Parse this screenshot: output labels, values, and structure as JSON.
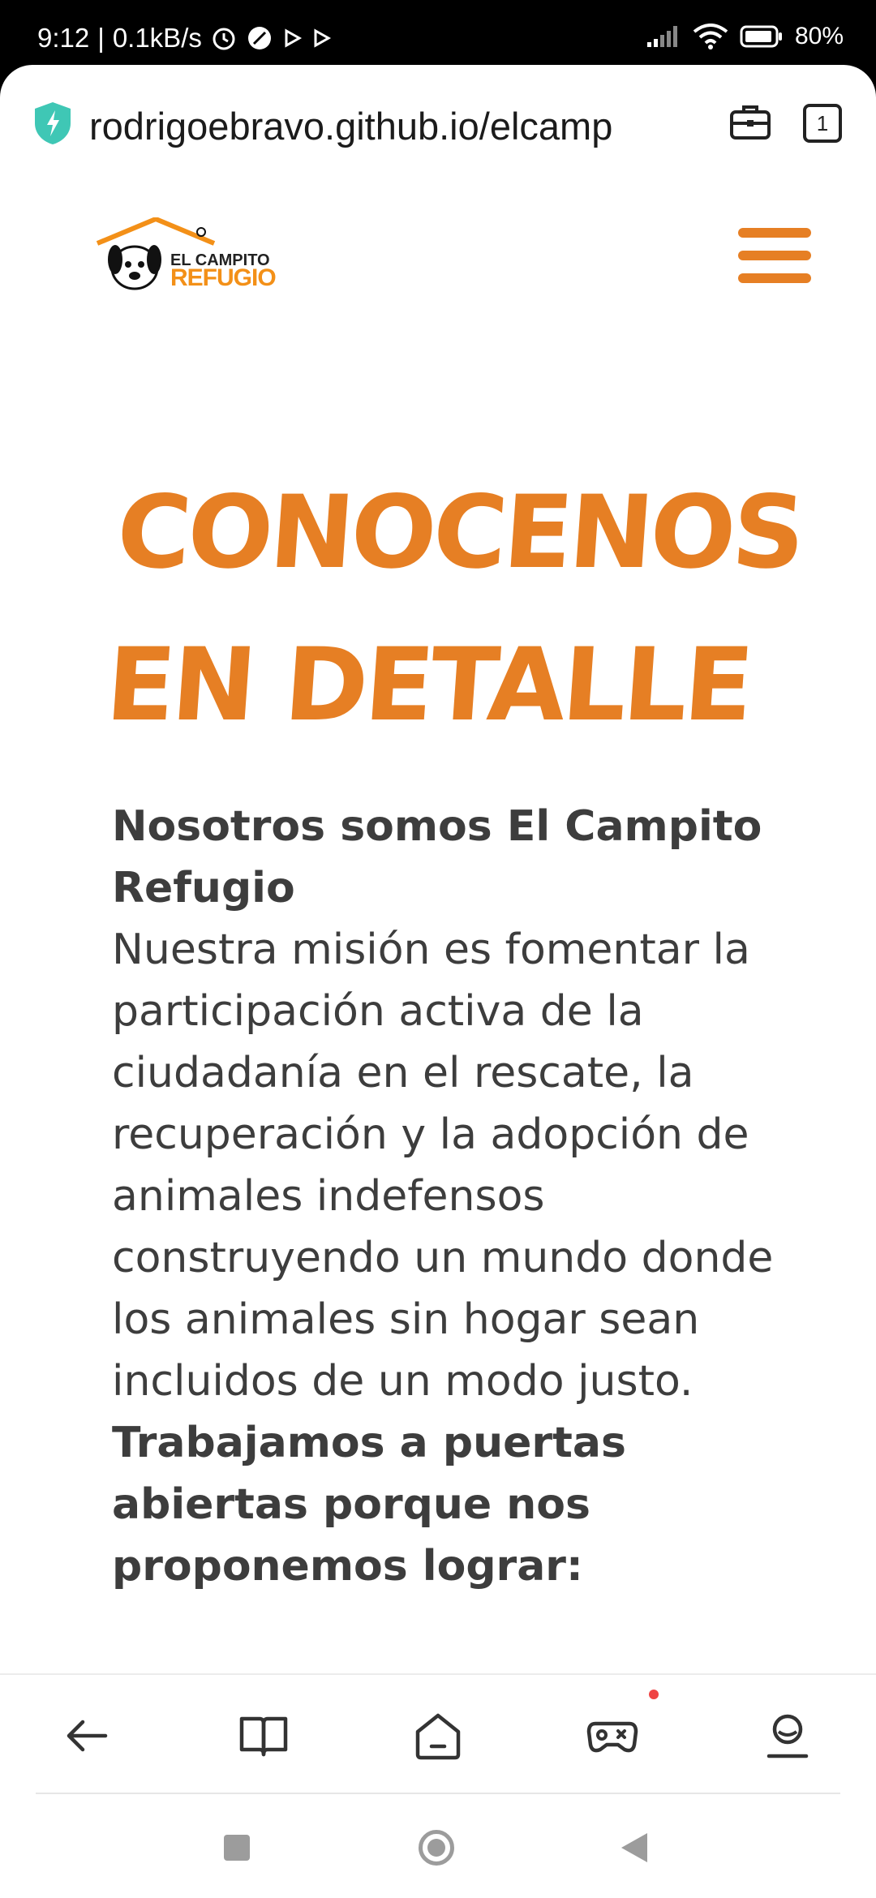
{
  "status_bar": {
    "time": "9:12",
    "network_speed": "0.1kB/s",
    "battery": "80%"
  },
  "browser": {
    "url": "rodrigoebravo.github.io/elcamp",
    "tab_count": "1"
  },
  "site": {
    "logo_line1": "EL CAMPITO",
    "logo_line2": "REFUGIO",
    "logo_mark": "®"
  },
  "main": {
    "title": "Conocenos en detalle",
    "heading1": "Nosotros somos El Campito Refugio",
    "paragraph1": "Nuestra misión es fomentar la participación activa de la ciudadanía en el rescate, la recuperación y la adopción de animales indefensos construyendo un mundo donde los animales sin hogar sean incluidos de un modo justo.",
    "heading2": "Trabajamos a puertas abiertas porque nos proponemos lograr:"
  },
  "colors": {
    "accent": "#e67f24",
    "text": "#3d3d3d"
  },
  "bottom_nav": {
    "items": [
      "back-icon",
      "book-icon",
      "home-icon",
      "game-controller-icon",
      "profile-icon"
    ]
  }
}
